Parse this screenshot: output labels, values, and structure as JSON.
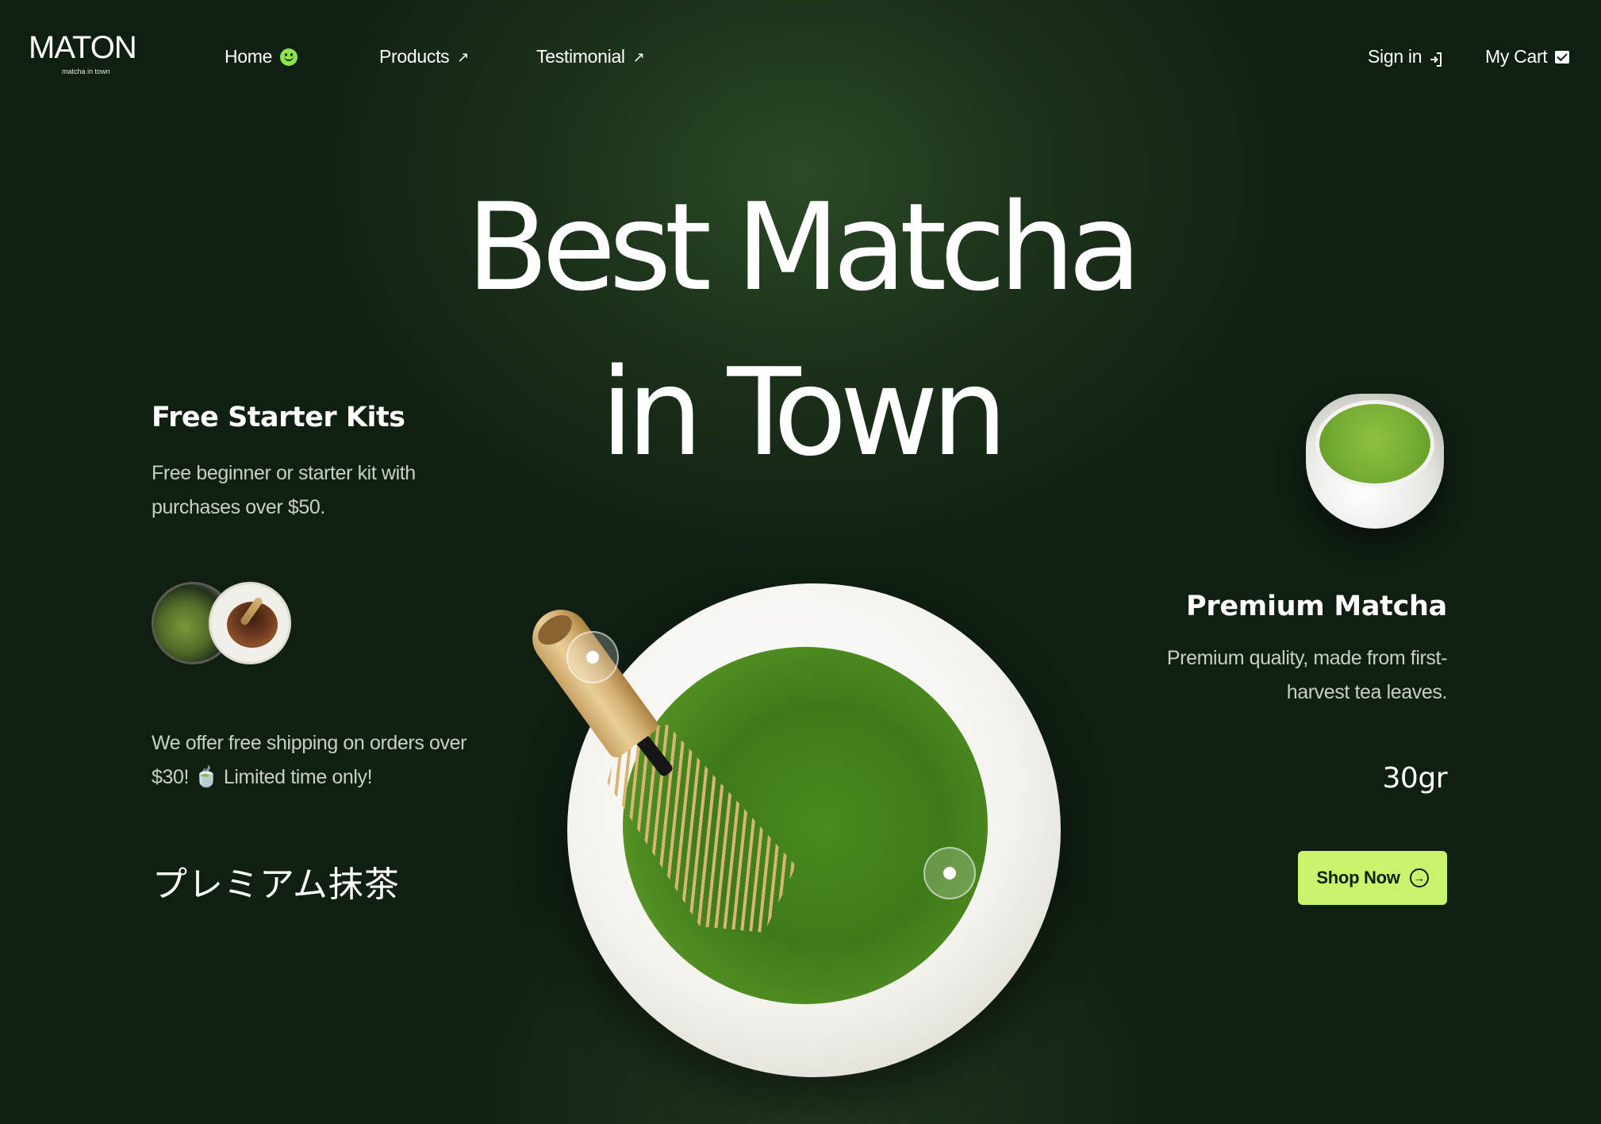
{
  "brand": {
    "name": "MATON",
    "tagline": "matcha in town"
  },
  "nav": {
    "home": {
      "label": "Home",
      "icon": "smile-icon"
    },
    "products": {
      "label": "Products",
      "icon": "arrow-up-right-icon",
      "arrow": "↗"
    },
    "testimonial": {
      "label": "Testimonial",
      "icon": "arrow-up-right-icon",
      "arrow": "↗"
    },
    "sign_in": {
      "label": "Sign in",
      "icon": "sign-in-icon"
    },
    "cart": {
      "label": "My Cart",
      "icon": "cart-icon"
    }
  },
  "hero": {
    "line1": "Best Matcha",
    "line2": "in Town"
  },
  "left": {
    "kit_title": "Free Starter Kits",
    "kit_desc": "Free beginner or starter kit with purchases over $50.",
    "shipping": "We offer free shipping on orders over $30! 🍵 Limited time only!",
    "japanese": "プレミアム抹茶"
  },
  "right": {
    "title": "Premium Matcha",
    "desc": "Premium quality, made from first-harvest tea leaves.",
    "weight": "30gr",
    "cta": {
      "label": "Shop Now",
      "icon": "circle-arrow-right-icon",
      "arrow": "→"
    }
  },
  "colors": {
    "background": "#0f1f12",
    "accent": "#c9f36a",
    "home_badge": "#8ee34a"
  }
}
